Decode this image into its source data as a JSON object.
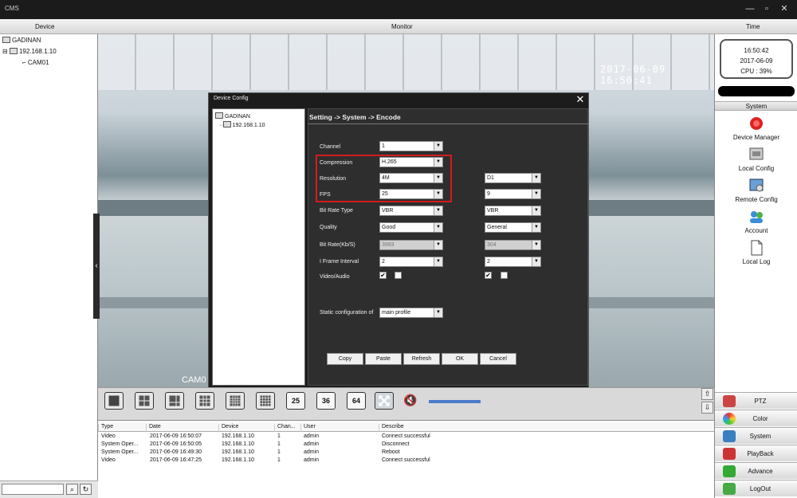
{
  "window": {
    "title": "CMS",
    "minimize": "—",
    "maximize": "▫",
    "close": "✕"
  },
  "header": {
    "device": "Device",
    "monitor": "Monitor",
    "time": "Time"
  },
  "tree": {
    "root": "GADINAN",
    "ip": "192.168.1.10",
    "camera": "CAM01",
    "search_value": ""
  },
  "video": {
    "osd_time": "2017-06-09 16:50:41",
    "osd_cam": "CAM0"
  },
  "dialog": {
    "title": "Device Config",
    "tree_root": "GADINAN",
    "tree_ip": "192.168.1.10",
    "breadcrumb": "Setting -> System -> Encode",
    "labels": {
      "channel": "Channel",
      "compression": "Compression",
      "resolution": "Resolution",
      "fps": "FPS",
      "bitrate_type": "Bit Rate Type",
      "quality": "Quality",
      "bitrate": "Bit Rate(Kb/S)",
      "iframe": "I Frame Interval",
      "video_audio": "Video/Audio",
      "static_config": "Static configuration of"
    },
    "main": {
      "channel": "1",
      "compression": "H.265",
      "resolution": "4M",
      "fps": "25",
      "bitrate_type": "VBR",
      "quality": "Good",
      "bitrate": "3993",
      "iframe": "2",
      "video_checked": "✔",
      "audio_checked": ""
    },
    "extra": {
      "resolution": "D1",
      "fps": "9",
      "bitrate_type": "VBR",
      "quality": "General",
      "bitrate": "304",
      "iframe": "2",
      "video_checked": "✔",
      "audio_checked": ""
    },
    "static_profile": "main profile",
    "buttons": {
      "copy": "Copy",
      "paste": "Paste",
      "refresh": "Refresh",
      "ok": "OK",
      "cancel": "Cancel"
    }
  },
  "right": {
    "clock_time": "16:50:42",
    "clock_date": "2017-06-09",
    "cpu": "CPU : 39%",
    "section": "System",
    "items": {
      "device_manager": "Device Manager",
      "local_config": "Local Config",
      "remote_config": "Remote Config",
      "account": "Account",
      "local_log": "Local Log"
    },
    "buttons": {
      "ptz": "PTZ",
      "color": "Color",
      "system": "System",
      "playback": "PlayBack",
      "advance": "Advance",
      "logout": "LogOut"
    }
  },
  "toolbar": {
    "layouts": [
      "",
      "",
      "",
      "",
      "",
      "",
      "25",
      "36",
      "64"
    ]
  },
  "log": {
    "columns": [
      "Type",
      "Date",
      "Device",
      "Chan...",
      "User",
      "Describe"
    ],
    "rows": [
      [
        "Video",
        "2017-06-09 16:50:07",
        "192.168.1.10",
        "1",
        "admin",
        "Connect successful"
      ],
      [
        "System Oper...",
        "2017-06-09 16:50:05",
        "192.168.1.10",
        "1",
        "admin",
        "Disconnect"
      ],
      [
        "System Oper...",
        "2017-06-09 16:49:30",
        "192.168.1.10",
        "1",
        "admin",
        "Reboot"
      ],
      [
        "Video",
        "2017-06-09 16:47:25",
        "192.168.1.10",
        "1",
        "admin",
        "Connect successful"
      ]
    ]
  },
  "colors": {
    "highlight": "#d21c1c",
    "volume": "#4a7cc9"
  }
}
